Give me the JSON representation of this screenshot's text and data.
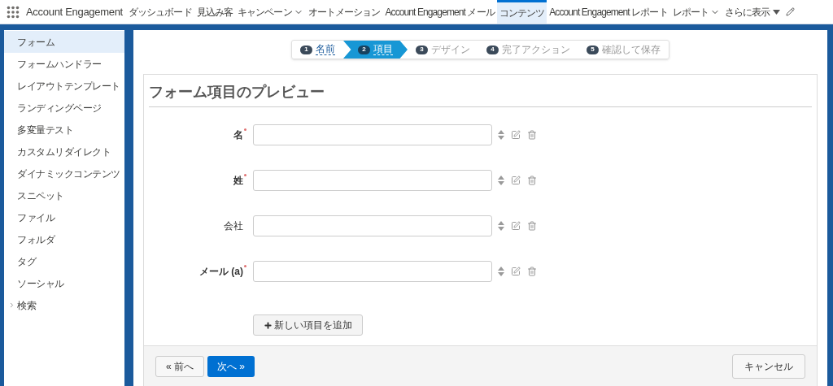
{
  "app": {
    "name": "Account Engagement"
  },
  "nav": [
    {
      "label": "ダッシュボード",
      "dropdown": false,
      "selected": false
    },
    {
      "label": "見込み客",
      "dropdown": false,
      "selected": false
    },
    {
      "label": "キャンペーン",
      "dropdown": true,
      "selected": false
    },
    {
      "label": "オートメーション",
      "dropdown": false,
      "selected": false
    },
    {
      "label": "Account Engagement メール",
      "dropdown": false,
      "selected": false
    },
    {
      "label": "コンテンツ",
      "dropdown": false,
      "selected": true
    },
    {
      "label": "Account Engagement レポート",
      "dropdown": false,
      "selected": false
    },
    {
      "label": "レポート",
      "dropdown": true,
      "selected": false
    },
    {
      "label": "さらに表示",
      "dropdown": true,
      "selected": false
    }
  ],
  "sidebar": {
    "items": [
      {
        "label": "フォーム",
        "selected": true,
        "expandable": false
      },
      {
        "label": "フォームハンドラー",
        "selected": false,
        "expandable": false
      },
      {
        "label": "レイアウトテンプレート",
        "selected": false,
        "expandable": false
      },
      {
        "label": "ランディングページ",
        "selected": false,
        "expandable": false
      },
      {
        "label": "多変量テスト",
        "selected": false,
        "expandable": false
      },
      {
        "label": "カスタムリダイレクト",
        "selected": false,
        "expandable": false
      },
      {
        "label": "ダイナミックコンテンツ",
        "selected": false,
        "expandable": false
      },
      {
        "label": "スニペット",
        "selected": false,
        "expandable": false
      },
      {
        "label": "ファイル",
        "selected": false,
        "expandable": false
      },
      {
        "label": "フォルダ",
        "selected": false,
        "expandable": false
      },
      {
        "label": "タグ",
        "selected": false,
        "expandable": false
      },
      {
        "label": "ソーシャル",
        "selected": false,
        "expandable": false
      },
      {
        "label": "検索",
        "selected": false,
        "expandable": true
      }
    ]
  },
  "wizard": {
    "steps": [
      {
        "number": "1",
        "label": "名前",
        "selected": false,
        "completed": true
      },
      {
        "number": "2",
        "label": "項目",
        "selected": true,
        "completed": true
      },
      {
        "number": "3",
        "label": "デザイン",
        "selected": false,
        "completed": false
      },
      {
        "number": "4",
        "label": "完了アクション",
        "selected": false,
        "completed": false
      },
      {
        "number": "5",
        "label": "確認して保存",
        "selected": false,
        "completed": false
      }
    ]
  },
  "panel": {
    "title": "フォーム項目のプレビュー",
    "fields": [
      {
        "label": "名",
        "required": true
      },
      {
        "label": "姓",
        "required": true
      },
      {
        "label": "会社",
        "required": false
      },
      {
        "label": "メール (a)",
        "required": true
      }
    ],
    "add_button": "新しい項目を追加"
  },
  "footer": {
    "previous": "« 前へ",
    "next": "次へ »",
    "cancel": "キャンセル"
  }
}
